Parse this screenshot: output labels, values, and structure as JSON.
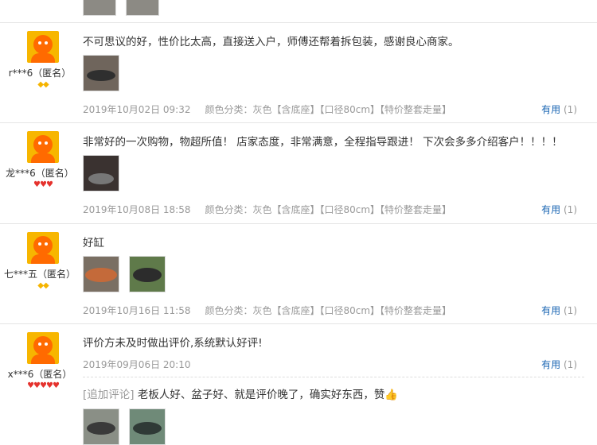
{
  "reviews": [
    {
      "username": "r***6（匿名）",
      "level_icon": "yellow-diamond-icon",
      "content": "不可思议的好，性价比太高，直接送入户，师傅还帮着拆包装，感谢良心商家。",
      "date": "2019年10月02日 09:32",
      "sku": "颜色分类：灰色【含底座】【口径80cm】【特价整套走量】",
      "useful_label": "有用",
      "useful_count": "(1)"
    },
    {
      "username": "龙***6（匿名）",
      "level_icon": "red-heart-icon",
      "content": "非常好的一次购物，物超所值！ 店家态度，非常满意，全程指导跟进！ 下次会多多介绍客户！！！！",
      "date": "2019年10月08日 18:58",
      "sku": "颜色分类：灰色【含底座】【口径80cm】【特价整套走量】",
      "useful_label": "有用",
      "useful_count": "(1)"
    },
    {
      "username": "七***五（匿名）",
      "level_icon": "yellow-diamond-icon",
      "content": "好缸",
      "date": "2019年10月16日 11:58",
      "sku": "颜色分类：灰色【含底座】【口径80cm】【特价整套走量】",
      "useful_label": "有用",
      "useful_count": "(1)"
    },
    {
      "username": "x***6（匿名）",
      "level_icon": "red-heart-icon",
      "content": "评价方未及时做出评价,系统默认好评!",
      "date": "2019年09月06日 20:10",
      "useful_label": "有用",
      "useful_count": "(1)",
      "append_tag": "[追加评论]",
      "append_text": "老板人好、盆子好、就是评价晚了，确实好东西，赞👍"
    }
  ]
}
